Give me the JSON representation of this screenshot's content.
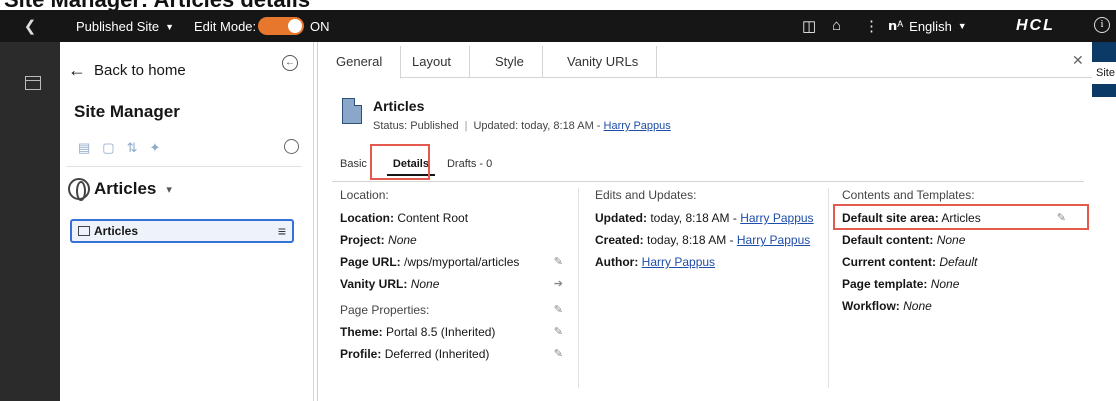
{
  "caption": "Site Manager: Articles details",
  "topbar": {
    "site_selector": "Published Site",
    "edit_mode_label": "Edit Mode:",
    "edit_mode_state": "ON",
    "language": "English",
    "logo": "HCL",
    "accent_color": "#e8772e"
  },
  "left_panel": {
    "back_label": "Back to home",
    "title": "Site Manager",
    "section_title": "Articles",
    "tree_item": "Articles"
  },
  "right_strip": {
    "label": "Site"
  },
  "dialog": {
    "tabs": [
      "General",
      "Layout",
      "Style",
      "Vanity URLs"
    ],
    "item_title": "Articles",
    "status_label": "Status: Published",
    "updated_label": "Updated: today, 8:18 AM -",
    "updated_user": "Harry Pappus",
    "subtabs": {
      "basic": "Basic",
      "details": "Details",
      "drafts": "Drafts - 0"
    },
    "location": {
      "heading": "Location:",
      "location_label": "Location:",
      "location_value": "Content Root",
      "project_label": "Project:",
      "project_value": "None",
      "page_url_label": "Page URL:",
      "page_url_value": "/wps/myportal/articles",
      "vanity_label": "Vanity URL:",
      "vanity_value": "None",
      "props_heading": "Page Properties:",
      "theme_label": "Theme:",
      "theme_value": "Portal 8.5 (Inherited)",
      "profile_label": "Profile:",
      "profile_value": "Deferred (Inherited)"
    },
    "edits": {
      "heading": "Edits and Updates:",
      "updated_label": "Updated:",
      "updated_value": "today, 8:18 AM -",
      "updated_user": "Harry Pappus",
      "created_label": "Created:",
      "created_value": "today, 8:18 AM -",
      "created_user": "Harry Pappus",
      "author_label": "Author:",
      "author_user": "Harry Pappus"
    },
    "contents": {
      "heading": "Contents and Templates:",
      "default_site_area_label": "Default site area:",
      "default_site_area_value": "Articles",
      "default_content_label": "Default content:",
      "default_content_value": "None",
      "current_content_label": "Current content:",
      "current_content_value": "Default",
      "page_template_label": "Page template:",
      "page_template_value": "None",
      "workflow_label": "Workflow:",
      "workflow_value": "None"
    },
    "highlight_color": "#e25a4c"
  }
}
